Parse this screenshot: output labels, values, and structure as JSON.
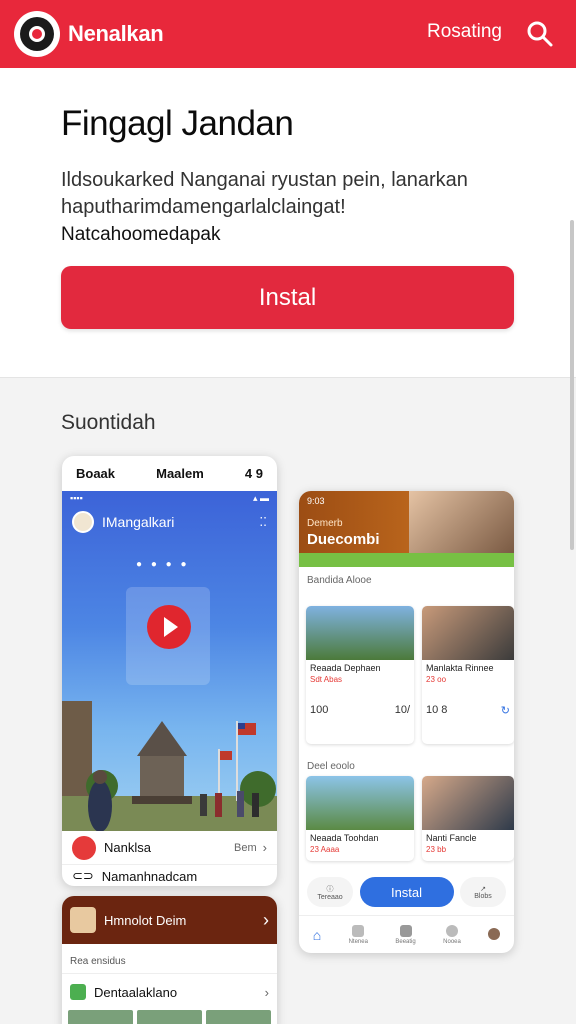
{
  "topbar": {
    "app_name": "Nenalkan",
    "link": "Rosating",
    "logo_icon": "shield-logo-icon",
    "search_icon": "search-icon",
    "color": "#e8283b"
  },
  "hero": {
    "title": "Fingagl Jandan",
    "description": "Ildsoukarked Nanganai ryustan pein, lanarkan haputharimdamengarlalclaingat!",
    "subtext": "Natcahoomedapak",
    "install_label": "Instal"
  },
  "section": {
    "title": "Suontidah"
  },
  "phone1": {
    "status_left": "Boaak",
    "status_center": "Maalem",
    "status_right": "4 9",
    "app_title": "IMangalkari",
    "nav_item_label": "Nanklsa",
    "nav_item_meta": "Bem",
    "nav_item2_label": "Namanhnadcam"
  },
  "phone2": {
    "header_status": "9:03",
    "header_label": "Demerb",
    "header_title": "Duecombi",
    "section1_label": "Bandida Alooe",
    "card1_title": "Reaada Dephaen",
    "card1_sub": "Sdt Abas",
    "card1_num_left": "100",
    "card1_num_right": "10/",
    "card2_title": "Manlakta",
    "card2_title_b": "Rinnee",
    "card2_sub": "23 oo",
    "card2_num_left": "10 8",
    "section2_label": "Deel eoolo",
    "card3_title": "Neaada Toohdan",
    "card3_sub": "23 Aaaa",
    "card4_title": "Nanti",
    "card4_title_b": "Fancle",
    "card4_sub": "23 bb",
    "cta_left": "Tereaao",
    "cta_main": "Instal",
    "cta_right": "Blobs",
    "tabs": [
      "",
      "Ntenea",
      "Beeatig",
      "Nooea",
      ""
    ]
  },
  "phone3": {
    "header_title": "Hmnolot Deim",
    "sub_label": "Rea ensidus",
    "row_label": "Dentaalaklano"
  }
}
